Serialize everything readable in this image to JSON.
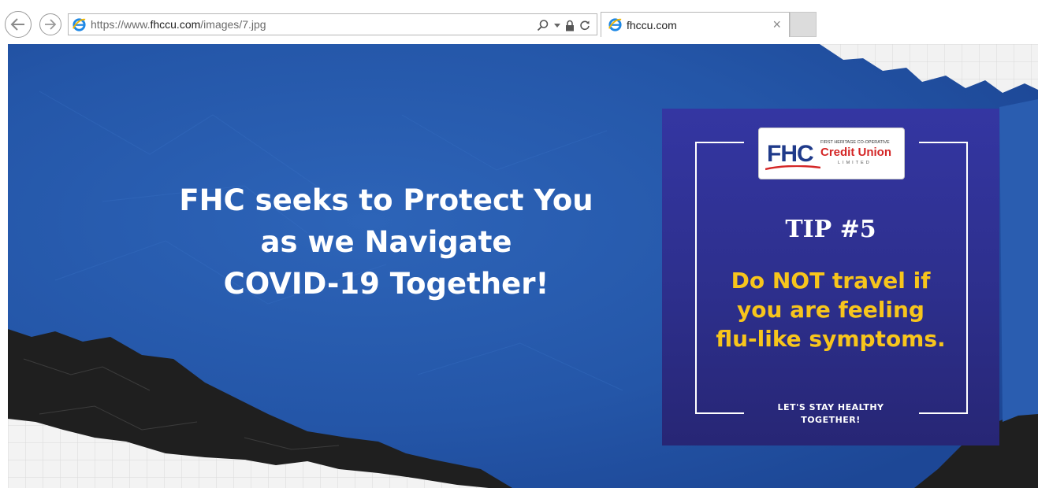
{
  "browser": {
    "url_prefix": "https://www.",
    "url_domain": "fhccu.com",
    "url_path": "/images/7.jpg",
    "tab_title": "fhccu.com",
    "tab_close": "×",
    "icons": [
      "back-icon",
      "forward-icon",
      "ie-icon",
      "search-icon",
      "dropdown-icon",
      "lock-icon",
      "refresh-icon"
    ]
  },
  "image": {
    "headline_lines": [
      "FHC seeks to Protect You",
      "as we Navigate",
      "COVID-19 Together!"
    ],
    "logo": {
      "mark": "FHC",
      "small_text": "FIRST HERITAGE CO-OPERATIVE",
      "name": "Credit Union",
      "suffix": "LIMITED"
    },
    "tip_title": "TIP #5",
    "tip_lines": [
      "Do NOT travel if",
      "you are feeling",
      "flu-like symptoms."
    ],
    "footer_lines": [
      "LET'S STAY HEALTHY",
      "TOGETHER!"
    ],
    "colors": {
      "background_blue": "#2456a8",
      "card_purple": "#3436a2",
      "tip_yellow": "#f7c51c",
      "logo_red": "#d42626",
      "logo_blue": "#1f3a8a"
    }
  }
}
